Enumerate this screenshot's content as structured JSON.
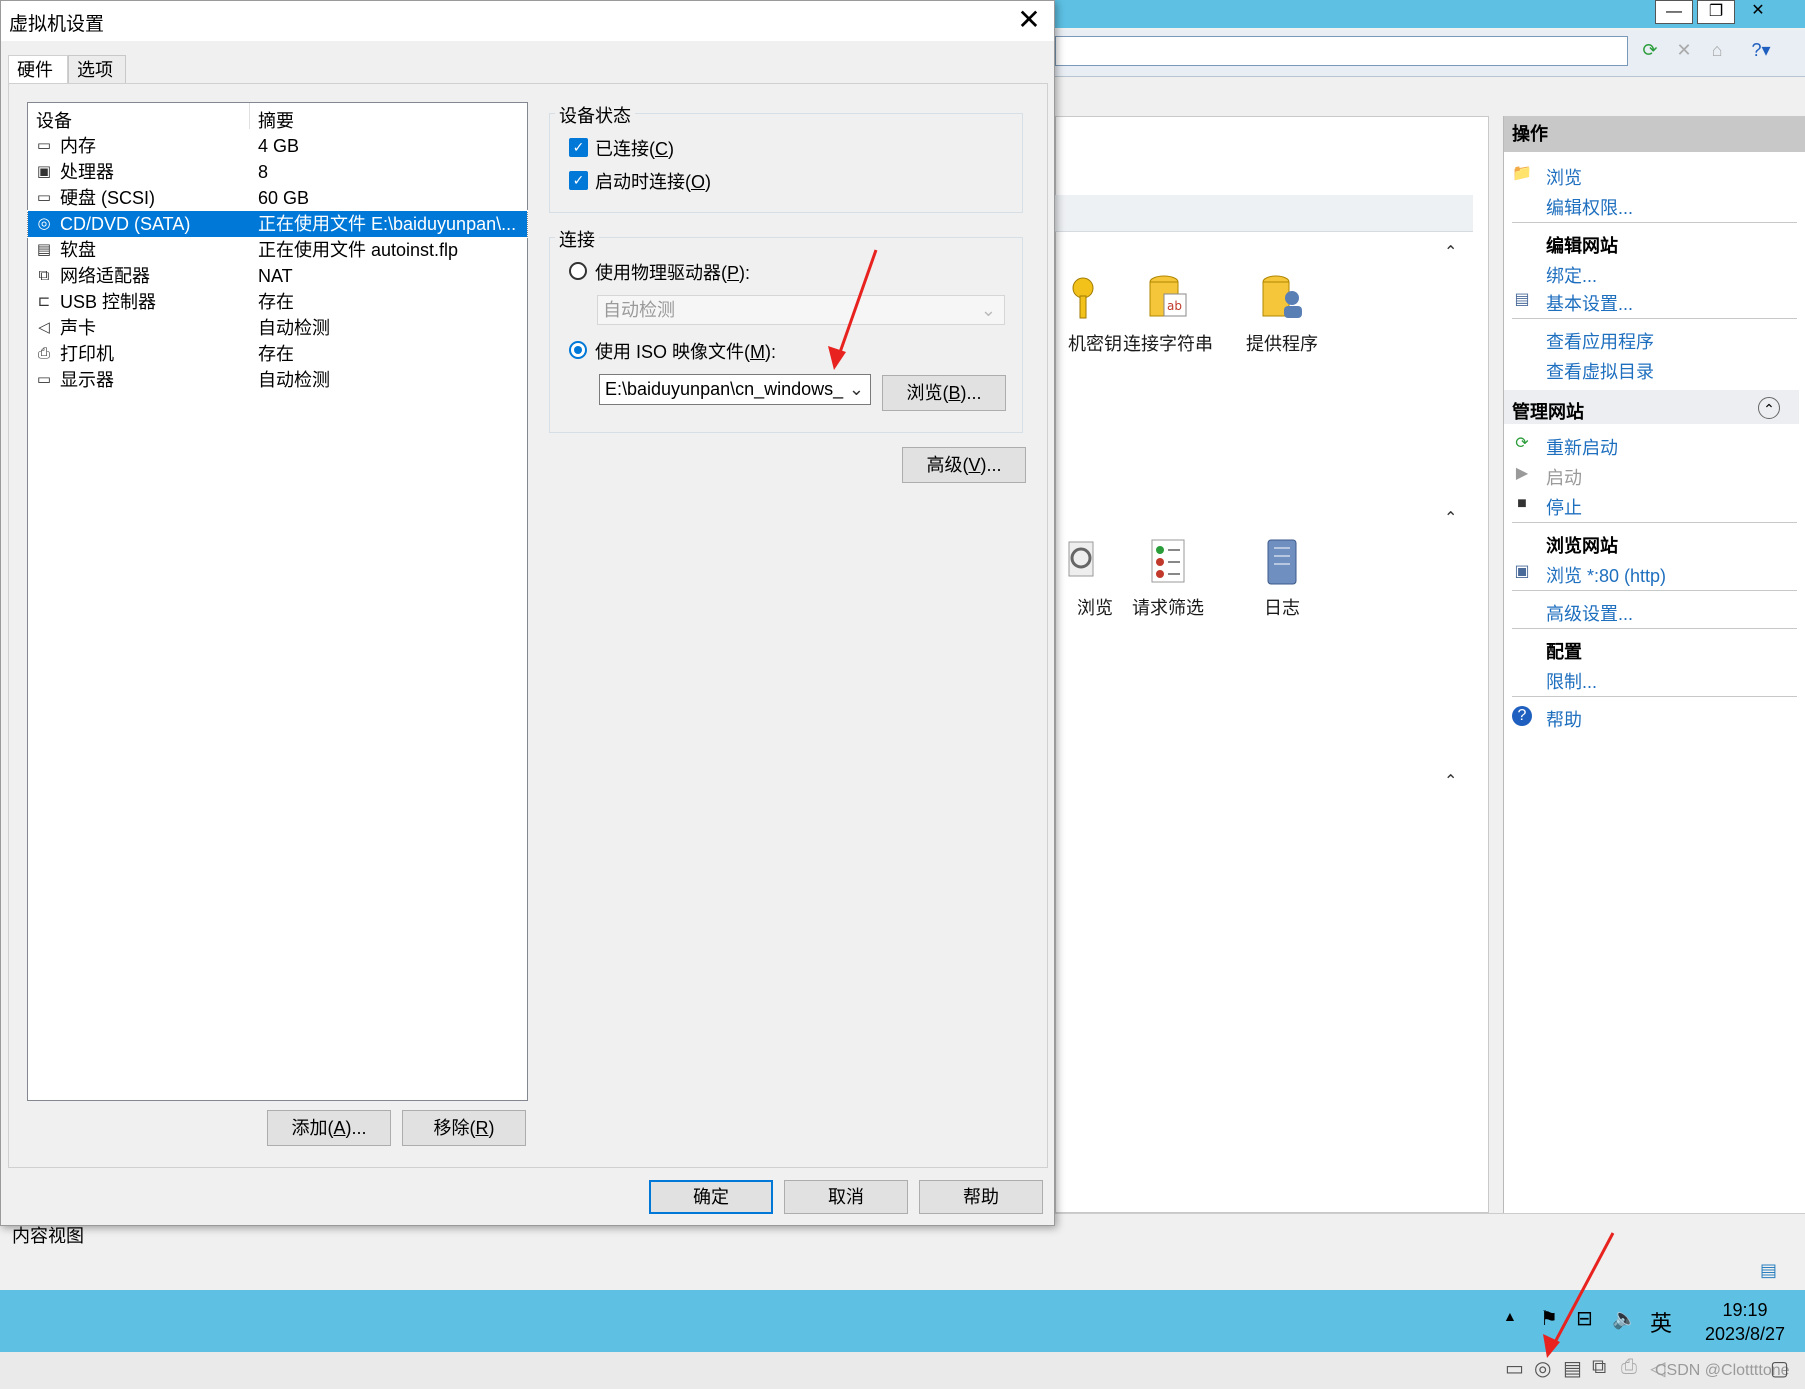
{
  "dialog": {
    "title": "虚拟机设置",
    "close_glyph": "✕",
    "tabs": [
      "硬件",
      "选项"
    ],
    "list_headers": {
      "device": "设备",
      "summary": "摘要"
    },
    "devices": [
      {
        "name": "内存",
        "summary": "4 GB",
        "icon": "memory-icon",
        "glyph": "▭"
      },
      {
        "name": "处理器",
        "summary": "8",
        "icon": "processor-icon",
        "glyph": "▣"
      },
      {
        "name": "硬盘 (SCSI)",
        "summary": "60 GB",
        "icon": "hard-disk-icon",
        "glyph": "▭"
      },
      {
        "name": "CD/DVD (SATA)",
        "summary": "正在使用文件 E:\\baiduyunpan\\...",
        "icon": "cd-dvd-icon",
        "glyph": "◎",
        "selected": true
      },
      {
        "name": "软盘",
        "summary": "正在使用文件 autoinst.flp",
        "icon": "floppy-icon",
        "glyph": "▤"
      },
      {
        "name": "网络适配器",
        "summary": "NAT",
        "icon": "network-adapter-icon",
        "glyph": "⧉"
      },
      {
        "name": "USB 控制器",
        "summary": "存在",
        "icon": "usb-controller-icon",
        "glyph": "⊏"
      },
      {
        "name": "声卡",
        "summary": "自动检测",
        "icon": "sound-card-icon",
        "glyph": "◁"
      },
      {
        "name": "打印机",
        "summary": "存在",
        "icon": "printer-icon",
        "glyph": "⎙"
      },
      {
        "name": "显示器",
        "summary": "自动检测",
        "icon": "display-icon",
        "glyph": "▭"
      }
    ],
    "add_button": {
      "text": "添加(",
      "key": "A",
      "suffix": ")..."
    },
    "remove_button": {
      "text": "移除(",
      "key": "R",
      "suffix": ")"
    },
    "device_status": {
      "label": "设备状态",
      "connected": {
        "text": "已连接(",
        "key": "C",
        "suffix": ")",
        "checked": true
      },
      "connect_at_power_on": {
        "text": "启动时连接(",
        "key": "O",
        "suffix": ")",
        "checked": true
      }
    },
    "connection": {
      "label": "连接",
      "physical_drive": {
        "text": "使用物理驱动器(",
        "key": "P",
        "suffix": "):",
        "selected": false
      },
      "physical_drive_value": "自动检测",
      "iso_image": {
        "text": "使用 ISO 映像文件(",
        "key": "M",
        "suffix": "):",
        "selected": true
      },
      "iso_path": "E:\\baiduyunpan\\cn_windows_",
      "browse_button": {
        "text": "浏览(",
        "key": "B",
        "suffix": ")..."
      }
    },
    "advanced_button": {
      "text": "高级(",
      "key": "V",
      "suffix": ")..."
    },
    "ok_button": "确定",
    "cancel_button": "取消",
    "help_button": "帮助"
  },
  "iis": {
    "window_buttons": [
      "—",
      "❐",
      "✕"
    ],
    "features_row1": [
      "机密钥",
      "连接字符串",
      "提供程序"
    ],
    "features_row2": [
      "浏览",
      "请求筛选",
      "日志"
    ],
    "actions": {
      "header": "操作",
      "explore": "浏览",
      "edit_permissions": "编辑权限...",
      "edit_site_header": "编辑网站",
      "bindings": "绑定...",
      "basic_settings": "基本设置...",
      "view_applications": "查看应用程序",
      "view_virtual_dirs": "查看虚拟目录",
      "manage_site_header": "管理网站",
      "restart": "重新启动",
      "start": "启动",
      "stop": "停止",
      "browse_site_header": "浏览网站",
      "browse_80": "浏览 *:80 (http)",
      "advanced_settings": "高级设置...",
      "configure_header": "配置",
      "limits": "限制...",
      "help": "帮助"
    },
    "content_view_tab": "内容视图"
  },
  "taskbar": {
    "ime": "英",
    "time": "19:19",
    "date": "2023/8/27"
  },
  "watermark": "CSDN @Clottttone",
  "colors": {
    "accent": "#0078d7",
    "taskbar": "#5ec1e4",
    "link": "#1f6fbf",
    "arrow": "#e8231f"
  }
}
